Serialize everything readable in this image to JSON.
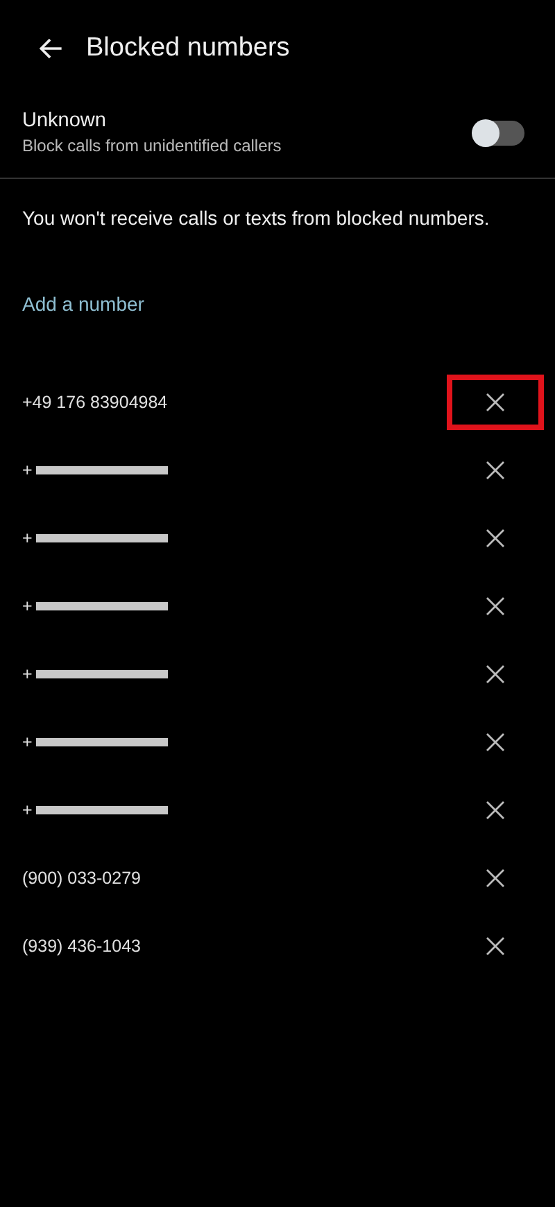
{
  "header": {
    "title": "Blocked numbers"
  },
  "unknown_setting": {
    "title": "Unknown",
    "subtitle": "Block calls from unidentified callers",
    "on": false
  },
  "info": "You won't receive calls or texts from blocked numbers.",
  "add_link": "Add a number",
  "numbers": [
    {
      "number": "+49 176 83904984",
      "redacted": false,
      "highlighted": true
    },
    {
      "number": "+",
      "redacted": true,
      "highlighted": false
    },
    {
      "number": "+",
      "redacted": true,
      "highlighted": false
    },
    {
      "number": "+",
      "redacted": true,
      "highlighted": false
    },
    {
      "number": "+",
      "redacted": true,
      "highlighted": false
    },
    {
      "number": "+",
      "redacted": true,
      "highlighted": false
    },
    {
      "number": "+",
      "redacted": true,
      "highlighted": false
    },
    {
      "number": "(900) 033-0279",
      "redacted": false,
      "highlighted": false
    },
    {
      "number": "(939) 436-1043",
      "redacted": false,
      "highlighted": false
    }
  ]
}
